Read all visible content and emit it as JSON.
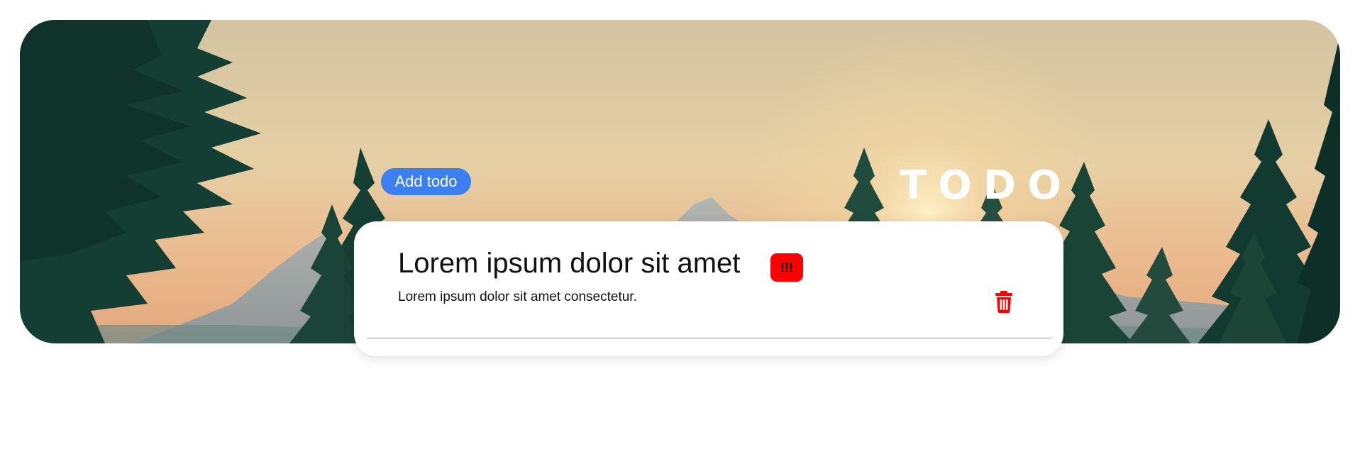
{
  "header": {
    "brand": "TODO",
    "add_button_label": "Add todo"
  },
  "todos": [
    {
      "title": "Lorem ipsum dolor sit amet",
      "priority": "!!!",
      "description": "Lorem ipsum dolor sit amet consectetur.",
      "delete_icon": "trash-icon"
    }
  ],
  "colors": {
    "accent": "#3b7ff0",
    "priority_high": "#ff0000",
    "delete": "#ff0000"
  }
}
